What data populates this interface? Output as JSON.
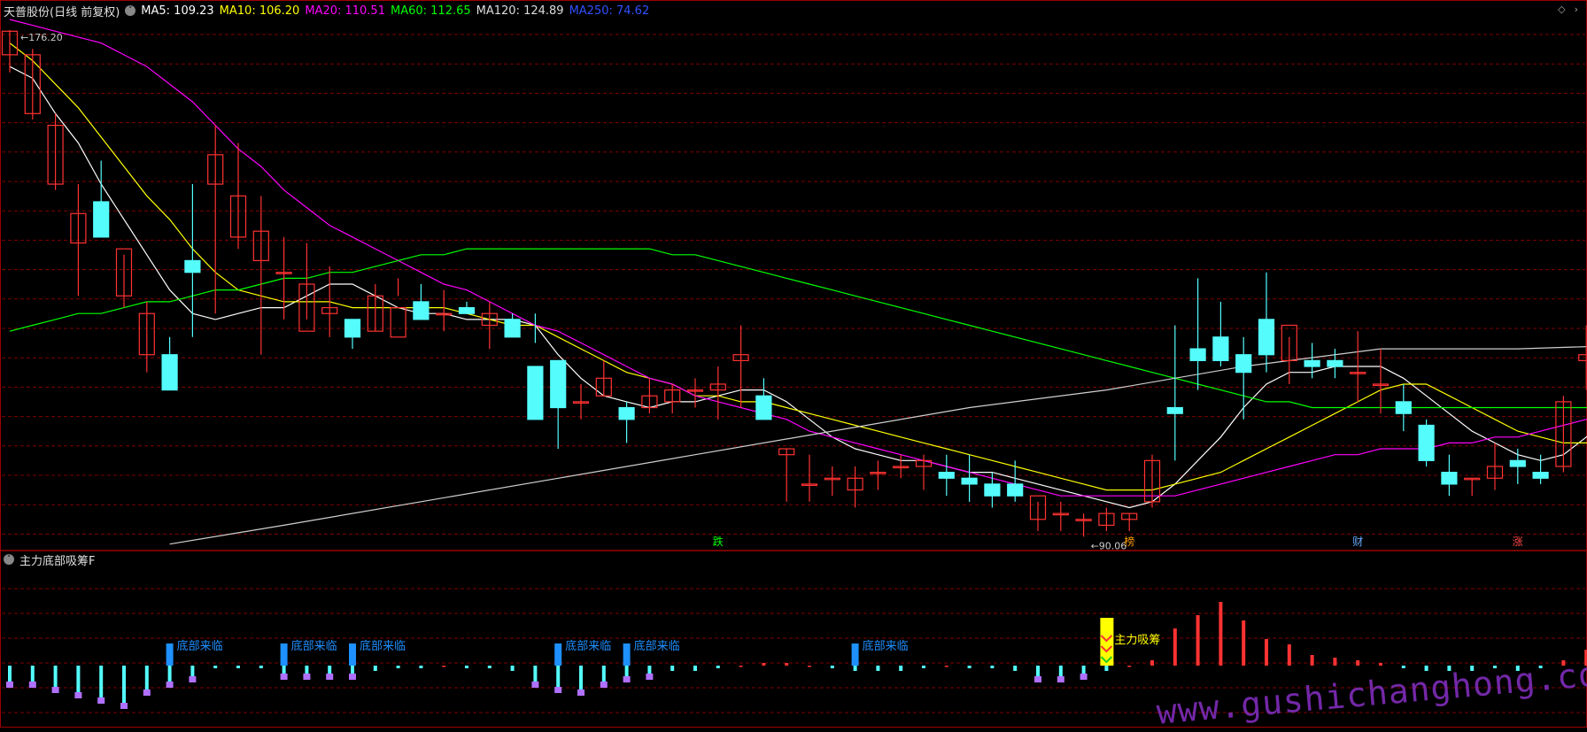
{
  "header": {
    "title": "天普股份(日线 前复权)",
    "ma_labels": [
      {
        "text": "MA5: 109.23",
        "color": "#ffffff"
      },
      {
        "text": "MA10: 106.20",
        "color": "#ffff00"
      },
      {
        "text": "MA20: 110.51",
        "color": "#ff00ff"
      },
      {
        "text": "MA60: 112.65",
        "color": "#00ff00"
      },
      {
        "text": "MA120: 124.89",
        "color": "#dddddd"
      },
      {
        "text": "MA250: 74.62",
        "color": "#3050ff"
      }
    ]
  },
  "sub_indicator": {
    "title": "主力底部吸筹F"
  },
  "annotations": {
    "high_label": "176.20",
    "low_label": "←90.06",
    "bottom_signal": "底部来临",
    "absorb_signal": "主力吸筹",
    "event_tags": [
      {
        "text": "跌",
        "color": "#00ff00",
        "bar": 31
      },
      {
        "text": "榜",
        "color": "#ff9900",
        "bar": 49
      },
      {
        "text": "财",
        "color": "#66aaff",
        "bar": 59
      },
      {
        "text": "涨",
        "color": "#ff4444",
        "bar": 66
      }
    ]
  },
  "watermark": "www.gushichanghong.com",
  "colors": {
    "up": "#ff3232",
    "down": "#54fcfc",
    "grid": "#800000",
    "border": "#a00000",
    "ma5": "#ffffff",
    "ma10": "#ffff00",
    "ma20": "#ff00ff",
    "ma60": "#00ff00",
    "ma120": "#d0d0d0",
    "sig_blue": "#1e90ff",
    "sig_purple": "#b070ff"
  },
  "chart_data": {
    "type": "candlestick",
    "y_range": [
      88,
      178
    ],
    "candles": [
      [
        172,
        176.2,
        169,
        176
      ],
      [
        162,
        173,
        161,
        172
      ],
      [
        150,
        162,
        149,
        160
      ],
      [
        140,
        150,
        131,
        145
      ],
      [
        147,
        154,
        143,
        141
      ],
      [
        131,
        138,
        129,
        139
      ],
      [
        121,
        130,
        118,
        128
      ],
      [
        121,
        124,
        118,
        115
      ],
      [
        137,
        150,
        124,
        135
      ],
      [
        150,
        160,
        128,
        155
      ],
      [
        141,
        157,
        139,
        148
      ],
      [
        137,
        148,
        121,
        142
      ],
      [
        135,
        141,
        127,
        135
      ],
      [
        125,
        140,
        127,
        133
      ],
      [
        128,
        136,
        124,
        129
      ],
      [
        127,
        127,
        122,
        124
      ],
      [
        125,
        133,
        125,
        131
      ],
      [
        124,
        134,
        131,
        129
      ],
      [
        130,
        133,
        128,
        127
      ],
      [
        128,
        132,
        125,
        128
      ],
      [
        129,
        130,
        128,
        128
      ],
      [
        126,
        130,
        122,
        128
      ],
      [
        127,
        128,
        125,
        124
      ],
      [
        119,
        128,
        123,
        110
      ],
      [
        120,
        115,
        105,
        112
      ],
      [
        113,
        116,
        110,
        113
      ],
      [
        114,
        120,
        114,
        117
      ],
      [
        112,
        113,
        106,
        110
      ],
      [
        112,
        117,
        111,
        114
      ],
      [
        113,
        116,
        111,
        115
      ],
      [
        115,
        117,
        112,
        115
      ],
      [
        115,
        119,
        110,
        116
      ],
      [
        120,
        126,
        112,
        121
      ],
      [
        114,
        117,
        110,
        110
      ],
      [
        104,
        105,
        96,
        105
      ],
      [
        99,
        104,
        96,
        99
      ],
      [
        100,
        102,
        97,
        100
      ],
      [
        98,
        102,
        95,
        100
      ],
      [
        101,
        103,
        98,
        101
      ],
      [
        102,
        104,
        100,
        102
      ],
      [
        102,
        104,
        98,
        103
      ],
      [
        101,
        104,
        97,
        100
      ],
      [
        100,
        104,
        96,
        99
      ],
      [
        99,
        101,
        95,
        97
      ],
      [
        99,
        103,
        96,
        97
      ],
      [
        93,
        96,
        91,
        97
      ],
      [
        94,
        96,
        91,
        94
      ],
      [
        93,
        94,
        90.06,
        93
      ],
      [
        92,
        95,
        91,
        94
      ],
      [
        93,
        94,
        91,
        94
      ],
      [
        96,
        104,
        95,
        103
      ],
      [
        112,
        126,
        103,
        111
      ],
      [
        122,
        134,
        115,
        120
      ],
      [
        124,
        130,
        119,
        120
      ],
      [
        121,
        124,
        110,
        118
      ],
      [
        127,
        135,
        118,
        121
      ],
      [
        120,
        124,
        116,
        126
      ],
      [
        120,
        123,
        117,
        119
      ],
      [
        120,
        122,
        117,
        119
      ],
      [
        118,
        125,
        113,
        118
      ],
      [
        116,
        122,
        111,
        116
      ],
      [
        113,
        116,
        108,
        111
      ],
      [
        109,
        110,
        102,
        103
      ],
      [
        101,
        104,
        97,
        99
      ],
      [
        100,
        100,
        97,
        100
      ],
      [
        100,
        106,
        98,
        102
      ],
      [
        103,
        105,
        99,
        102
      ],
      [
        101,
        104,
        99,
        100
      ],
      [
        102,
        114,
        101,
        113
      ],
      [
        120,
        126,
        115,
        121
      ],
      [
        123,
        124,
        108,
        115
      ]
    ],
    "series": [
      {
        "name": "MA5",
        "values": [
          170,
          168,
          162,
          157,
          150,
          144,
          138,
          132,
          128,
          127,
          128,
          129,
          129,
          131,
          133,
          133,
          131,
          129,
          128,
          128,
          127,
          127,
          127,
          126,
          121,
          117,
          114,
          113,
          112,
          113,
          113,
          114,
          115,
          115,
          113,
          110,
          107,
          105,
          104,
          103,
          103,
          102,
          101,
          101,
          100,
          99,
          98,
          97,
          96,
          95,
          96,
          99,
          103,
          107,
          112,
          116,
          118,
          118,
          119,
          119,
          119,
          117,
          114,
          111,
          108,
          106,
          104,
          103,
          104,
          107,
          110
        ]
      },
      {
        "name": "MA10",
        "values": [
          174,
          171,
          167,
          163,
          158,
          153,
          148,
          144,
          139,
          135,
          132,
          131,
          130,
          130,
          130,
          129,
          129,
          129,
          129,
          129,
          128,
          127,
          126,
          126,
          124,
          122,
          120,
          118,
          117,
          116,
          114,
          114,
          113,
          113,
          112,
          111,
          110,
          109,
          108,
          107,
          106,
          105,
          104,
          103,
          102,
          101,
          100,
          99,
          98,
          98,
          98,
          99,
          100,
          101,
          103,
          105,
          107,
          109,
          111,
          113,
          115,
          116,
          116,
          114,
          112,
          110,
          108,
          107,
          106,
          106,
          107
        ]
      },
      {
        "name": "MA20",
        "values": [
          178,
          177,
          176,
          175,
          174,
          172,
          170,
          167,
          164,
          160,
          156,
          153,
          149,
          146,
          143,
          141,
          139,
          137,
          135,
          133,
          132,
          130,
          128,
          126,
          125,
          123,
          121,
          119,
          117,
          116,
          114,
          113,
          112,
          111,
          110,
          108,
          107,
          106,
          105,
          104,
          103,
          102,
          101,
          100,
          99,
          98,
          97,
          97,
          97,
          97,
          97,
          97,
          98,
          99,
          100,
          101,
          102,
          103,
          104,
          104,
          105,
          105,
          105,
          106,
          106,
          107,
          107,
          108,
          109,
          110,
          110
        ]
      },
      {
        "name": "MA60",
        "values": [
          125,
          126,
          127,
          128,
          128,
          129,
          130,
          130,
          131,
          132,
          132,
          133,
          134,
          134,
          135,
          135,
          136,
          137,
          138,
          138,
          139,
          139,
          139,
          139,
          139,
          139,
          139,
          139,
          139,
          138,
          138,
          137,
          136,
          135,
          134,
          133,
          132,
          131,
          130,
          129,
          128,
          127,
          126,
          125,
          124,
          123,
          122,
          121,
          120,
          119,
          118,
          117,
          116,
          115,
          114,
          113,
          113,
          112,
          112,
          112,
          112,
          112,
          112,
          112,
          112,
          112,
          112,
          112,
          112,
          112,
          112
        ]
      },
      {
        "name": "MA120",
        "values": [
          null,
          null,
          null,
          null,
          null,
          null,
          null,
          null,
          null,
          null,
          null,
          null,
          null,
          null,
          null,
          null,
          null,
          null,
          null,
          null,
          null,
          null,
          null,
          null,
          null,
          null,
          null,
          null,
          null,
          null,
          null,
          null,
          null,
          null,
          null,
          null,
          null,
          null,
          null,
          null,
          null,
          null,
          null,
          null,
          null,
          null,
          null,
          null,
          null,
          null,
          null,
          null,
          null,
          null,
          null,
          null,
          null,
          null,
          null,
          null,
          null,
          null,
          null,
          null,
          null,
          null,
          null,
          null,
          null,
          null,
          null
        ]
      }
    ],
    "ma120_points": [
      [
        7,
        88.8
      ],
      [
        12,
        92
      ],
      [
        18,
        96
      ],
      [
        24,
        100
      ],
      [
        30,
        104
      ],
      [
        36,
        108
      ],
      [
        42,
        112
      ],
      [
        48,
        115
      ],
      [
        54,
        119
      ],
      [
        60,
        122
      ],
      [
        66,
        122
      ],
      [
        70,
        122.5
      ]
    ],
    "sub_series": {
      "y_range": [
        -17,
        29
      ],
      "bars": [
        -6,
        -6,
        -8,
        -10,
        -12,
        -14,
        -9,
        -6,
        -4,
        -1,
        -1,
        -1,
        -3,
        -3,
        -3,
        -3,
        -2,
        -1,
        -1,
        0,
        -1,
        -1,
        -2,
        -6,
        -8,
        -9,
        -6,
        -4,
        -3,
        -2,
        -2,
        -1,
        0,
        1,
        1,
        0,
        -1,
        -2,
        -2,
        -2,
        -1,
        0,
        -1,
        -1,
        -2,
        -4,
        -4,
        -3,
        -2,
        0,
        2,
        14,
        19,
        24,
        17,
        10,
        8,
        4,
        3,
        2,
        1,
        -1,
        -2,
        -2,
        -2,
        -1,
        -2,
        -1,
        2,
        6,
        5
      ],
      "bottom_signal_bars": [
        7,
        12,
        15,
        24,
        27,
        37
      ],
      "absorb_bar": 48
    }
  }
}
